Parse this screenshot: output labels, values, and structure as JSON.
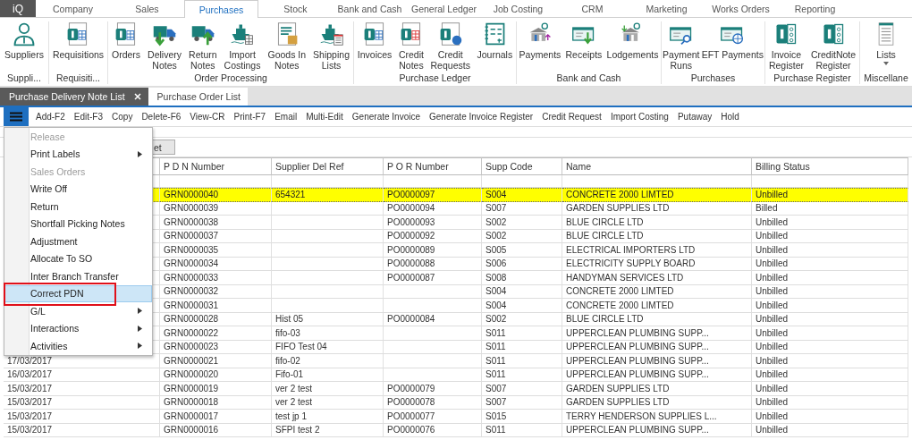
{
  "app_button": "iQ",
  "top_tabs": [
    {
      "label": "Company",
      "selected": false
    },
    {
      "label": "Sales",
      "selected": false
    },
    {
      "label": "Purchases",
      "selected": true
    },
    {
      "label": "Stock",
      "selected": false
    },
    {
      "label": "Bank and Cash",
      "selected": false
    },
    {
      "label": "General Ledger",
      "selected": false
    },
    {
      "label": "Job Costing",
      "selected": false
    },
    {
      "label": "CRM",
      "selected": false
    },
    {
      "label": "Marketing",
      "selected": false
    },
    {
      "label": "Works Orders",
      "selected": false
    },
    {
      "label": "Reporting",
      "selected": false
    }
  ],
  "ribbon": {
    "groups": [
      {
        "label": "Suppli...",
        "items": [
          {
            "lines": [
              "Suppliers"
            ]
          }
        ]
      },
      {
        "label": "Requisiti...",
        "items": [
          {
            "lines": [
              "Requisitions"
            ]
          }
        ]
      },
      {
        "label": "Order Processing",
        "items": [
          {
            "lines": [
              "Orders"
            ]
          },
          {
            "lines": [
              "Delivery",
              "Notes"
            ]
          },
          {
            "lines": [
              "Return",
              "Notes"
            ]
          },
          {
            "lines": [
              "Import",
              "Costings"
            ]
          },
          {
            "lines": [
              "Goods In",
              "Notes"
            ]
          },
          {
            "lines": [
              "Shipping",
              "Lists"
            ]
          }
        ]
      },
      {
        "label": "Purchase Ledger",
        "items": [
          {
            "lines": [
              "Invoices"
            ]
          },
          {
            "lines": [
              "Credit",
              "Notes"
            ]
          },
          {
            "lines": [
              "Credit",
              "Requests"
            ]
          },
          {
            "lines": [
              "Journals"
            ]
          }
        ]
      },
      {
        "label": "Bank and Cash",
        "items": [
          {
            "lines": [
              "Payments"
            ]
          },
          {
            "lines": [
              "Receipts"
            ]
          },
          {
            "lines": [
              "Lodgements"
            ]
          }
        ]
      },
      {
        "label": "Purchases",
        "items": [
          {
            "lines": [
              "Payment",
              "Runs"
            ]
          },
          {
            "lines": [
              "EFT Payments"
            ]
          }
        ]
      },
      {
        "label": "Purchase Register",
        "items": [
          {
            "lines": [
              "Invoice",
              "Register"
            ]
          },
          {
            "lines": [
              "CreditNote",
              "Register"
            ]
          }
        ]
      },
      {
        "label": "Miscellane",
        "items": [
          {
            "lines": [
              "Lists"
            ],
            "dropdown": true
          }
        ]
      }
    ]
  },
  "document_tabs": [
    {
      "label": "Purchase Delivery Note List",
      "selected": true,
      "closable": true
    },
    {
      "label": "Purchase Order List",
      "selected": false,
      "closable": false
    }
  ],
  "toolbar": [
    "Add-F2",
    "Edit-F3",
    "Copy",
    "Delete-F6",
    "View-CR",
    "Print-F7",
    "Email",
    "Multi-Edit",
    "Generate Invoice",
    "Generate Invoice Register",
    "Credit Request",
    "Import Costing",
    "Putaway",
    "Hold"
  ],
  "filter_button": "et",
  "menu": [
    {
      "label": "Release",
      "disabled": true,
      "submenu": false,
      "selected": false,
      "marked": false
    },
    {
      "label": "Print Labels",
      "disabled": false,
      "submenu": true,
      "selected": false,
      "marked": false
    },
    {
      "label": "Sales Orders",
      "disabled": true,
      "submenu": false,
      "selected": false,
      "marked": false
    },
    {
      "label": "Write Off",
      "disabled": false,
      "submenu": false,
      "selected": false,
      "marked": false
    },
    {
      "label": "Return",
      "disabled": false,
      "submenu": false,
      "selected": false,
      "marked": false
    },
    {
      "label": "Shortfall Picking Notes",
      "disabled": false,
      "submenu": false,
      "selected": false,
      "marked": false
    },
    {
      "label": "Adjustment",
      "disabled": false,
      "submenu": false,
      "selected": false,
      "marked": false
    },
    {
      "label": "Allocate To SO",
      "disabled": false,
      "submenu": false,
      "selected": false,
      "marked": false
    },
    {
      "label": "Inter Branch Transfer",
      "disabled": false,
      "submenu": false,
      "selected": false,
      "marked": false
    },
    {
      "label": "Correct PDN",
      "disabled": false,
      "submenu": false,
      "selected": true,
      "marked": true
    },
    {
      "label": "G/L",
      "disabled": false,
      "submenu": true,
      "selected": false,
      "marked": false
    },
    {
      "label": "Interactions",
      "disabled": false,
      "submenu": true,
      "selected": false,
      "marked": false
    },
    {
      "label": "Activities",
      "disabled": false,
      "submenu": true,
      "selected": false,
      "marked": false
    }
  ],
  "table": {
    "columns": [
      "P D N Number",
      "Supplier Del Ref",
      "P O R Number",
      "Supp Code",
      "Name",
      "Billing Status"
    ],
    "rows": [
      {
        "pdn": "GRN0000040",
        "supplier_del_ref": "654321",
        "por_number": "PO0000097",
        "supp_code": "S004",
        "name": "CONCRETE 2000 LIMTED",
        "billing_status": "Unbilled",
        "selected": true
      },
      {
        "pdn": "GRN0000039",
        "por_number": "PO0000094",
        "supp_code": "S007",
        "name": "GARDEN SUPPLIES LTD",
        "billing_status": "Billed",
        "selected": false
      },
      {
        "pdn": "GRN0000038",
        "por_number": "PO0000093",
        "supp_code": "S002",
        "name": "BLUE CIRCLE LTD",
        "billing_status": "Unbilled",
        "selected": false
      },
      {
        "pdn": "GRN0000037",
        "por_number": "PO0000092",
        "supp_code": "S002",
        "name": "BLUE CIRCLE LTD",
        "billing_status": "Unbilled",
        "selected": false
      },
      {
        "pdn": "GRN0000035",
        "por_number": "PO0000089",
        "supp_code": "S005",
        "name": "ELECTRICAL IMPORTERS LTD",
        "billing_status": "Unbilled",
        "selected": false
      },
      {
        "pdn": "GRN0000034",
        "por_number": "PO0000088",
        "supp_code": "S006",
        "name": "ELECTRICITY SUPPLY BOARD",
        "billing_status": "Unbilled",
        "selected": false
      },
      {
        "pdn": "GRN0000033",
        "por_number": "PO0000087",
        "supp_code": "S008",
        "name": "HANDYMAN SERVICES LTD",
        "billing_status": "Unbilled",
        "selected": false
      },
      {
        "pdn": "GRN0000032",
        "supp_code": "S004",
        "name": "CONCRETE 2000 LIMTED",
        "billing_status": "Unbilled",
        "selected": false
      },
      {
        "pdn": "GRN0000031",
        "supp_code": "S004",
        "name": "CONCRETE 2000 LIMTED",
        "billing_status": "Unbilled",
        "selected": false
      },
      {
        "pdn": "GRN0000028",
        "supplier_del_ref": "Hist 05",
        "por_number": "PO0000084",
        "supp_code": "S002",
        "name": "BLUE CIRCLE LTD",
        "billing_status": "Unbilled",
        "selected": false
      },
      {
        "pdn": "GRN0000022",
        "supplier_del_ref": "fifo-03",
        "supp_code": "S011",
        "name": "UPPERCLEAN PLUMBING SUPP...",
        "billing_status": "Unbilled",
        "selected": false
      },
      {
        "pdn": "GRN0000023",
        "supplier_del_ref": "FIFO Test 04",
        "supp_code": "S011",
        "name": "UPPERCLEAN PLUMBING SUPP...",
        "billing_status": "Unbilled",
        "selected": false
      },
      {
        "date": "17/03/2017",
        "pdn": "GRN0000021",
        "supplier_del_ref": "fifo-02",
        "supp_code": "S011",
        "name": "UPPERCLEAN PLUMBING SUPP...",
        "billing_status": "Unbilled",
        "selected": false
      },
      {
        "date": "16/03/2017",
        "pdn": "GRN0000020",
        "supplier_del_ref": "Fifo-01",
        "supp_code": "S011",
        "name": "UPPERCLEAN PLUMBING SUPP...",
        "billing_status": "Unbilled",
        "selected": false
      },
      {
        "date": "15/03/2017",
        "pdn": "GRN0000019",
        "supplier_del_ref": "ver 2 test",
        "por_number": "PO0000079",
        "supp_code": "S007",
        "name": "GARDEN SUPPLIES LTD",
        "billing_status": "Unbilled",
        "selected": false
      },
      {
        "date": "15/03/2017",
        "pdn": "GRN0000018",
        "supplier_del_ref": "ver 2 test",
        "por_number": "PO0000078",
        "supp_code": "S007",
        "name": "GARDEN SUPPLIES LTD",
        "billing_status": "Unbilled",
        "selected": false
      },
      {
        "date": "15/03/2017",
        "pdn": "GRN0000017",
        "supplier_del_ref": "test jp 1",
        "por_number": "PO0000077",
        "supp_code": "S015",
        "name": "TERRY HENDERSON SUPPLIES L...",
        "billing_status": "Unbilled",
        "selected": false
      },
      {
        "date": "15/03/2017",
        "pdn": "GRN0000016",
        "supplier_del_ref": "SFPI test 2",
        "por_number": "PO0000076",
        "supp_code": "S011",
        "name": "UPPERCLEAN PLUMBING SUPP...",
        "billing_status": "Unbilled",
        "selected": false
      }
    ]
  }
}
